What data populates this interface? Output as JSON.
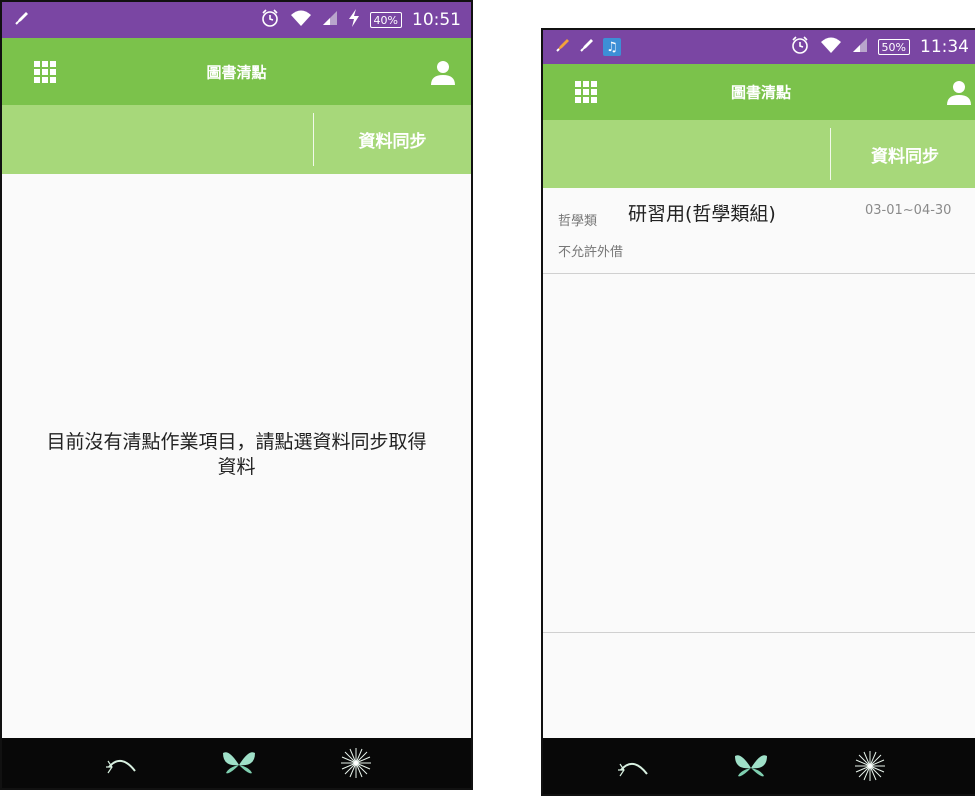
{
  "screen_empty": {
    "status_bar": {
      "notification_icons": [
        "rocket-icon"
      ],
      "alarm_icon": "alarm-icon",
      "wifi_icon": "wifi-icon",
      "signal_icon": "signal-icon",
      "charging_icon": "charging-icon",
      "battery_percent": "40%",
      "time": "10:51"
    },
    "app_bar": {
      "title": "圖書清點",
      "menu_icon": "grid-menu-icon",
      "user_icon": "user-icon"
    },
    "toolbar": {
      "sync_label": "資料同步"
    },
    "empty_message_line1": "目前沒有清點作業項目，請點選資料同步取得",
    "empty_message_line2": "資料",
    "bottom_nav": [
      "dandelion-seed-icon",
      "butterfly-icon",
      "dandelion-icon"
    ]
  },
  "screen_list": {
    "status_bar": {
      "notification_icons": [
        "rocket-icon",
        "rocket-icon",
        "music-note-icon"
      ],
      "alarm_icon": "alarm-icon",
      "wifi_icon": "wifi-icon",
      "signal_icon": "signal-icon",
      "battery_percent": "50%",
      "time": "11:34"
    },
    "app_bar": {
      "title": "圖書清點",
      "menu_icon": "grid-menu-icon",
      "user_icon": "user-icon"
    },
    "toolbar": {
      "sync_label": "資料同步"
    },
    "items": [
      {
        "category": "哲學類",
        "name": "研習用(哲學類組)",
        "date_range": "03-01~04-30",
        "status": "不允許外借"
      }
    ],
    "bottom_nav": [
      "dandelion-seed-icon",
      "butterfly-icon",
      "dandelion-icon"
    ]
  },
  "colors": {
    "status_bar": "#7a46a3",
    "app_bar": "#7bc24b",
    "toolbar": "#a7d87a",
    "bottom_bar": "#080808"
  }
}
